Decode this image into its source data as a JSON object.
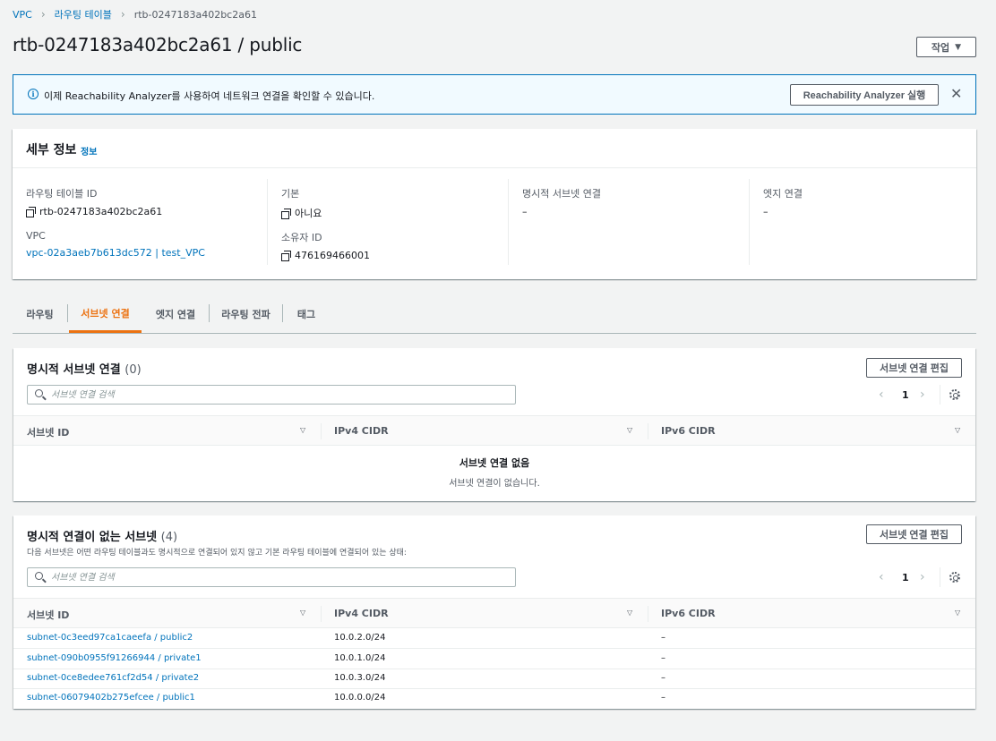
{
  "breadcrumb": {
    "items": [
      "VPC",
      "라우팅 테이블",
      "rtb-0247183a402bc2a61"
    ]
  },
  "header": {
    "title": "rtb-0247183a402bc2a61 / public",
    "actions_label": "작업"
  },
  "flash": {
    "message": "이제 Reachability Analyzer를 사용하여 네트워크 연결을 확인할 수 있습니다.",
    "button_label": "Reachability Analyzer 실행",
    "close_symbol": "✕"
  },
  "details": {
    "title": "세부 정보",
    "info_link": "정보",
    "route_table_id_label": "라우팅 테이블 ID",
    "route_table_id_value": "rtb-0247183a402bc2a61",
    "vpc_label": "VPC",
    "vpc_value": "vpc-02a3aeb7b613dc572 | test_VPC",
    "main_label": "기본",
    "main_value": "아니요",
    "owner_label": "소유자 ID",
    "owner_value": "476169466001",
    "explicit_subnet_label": "명시적 서브넷 연결",
    "explicit_subnet_value": "–",
    "edge_label": "엣지 연결",
    "edge_value": "–"
  },
  "tabs": [
    {
      "label": "라우팅"
    },
    {
      "label": "서브넷 연결"
    },
    {
      "label": "엣지 연결"
    },
    {
      "label": "라우팅 전파"
    },
    {
      "label": "태그"
    }
  ],
  "explicit": {
    "title": "명시적 서브넷 연결",
    "count": "(0)",
    "edit_label": "서브넷 연결 편집",
    "search_placeholder": "서브넷 연결 검색",
    "page": "1",
    "columns": [
      "서브넷 ID",
      "IPv4 CIDR",
      "IPv6 CIDR"
    ],
    "empty_title": "서브넷 연결 없음",
    "empty_sub": "서브넷 연결이 없습니다."
  },
  "implicit": {
    "title": "명시적 연결이 없는 서브넷",
    "count": "(4)",
    "description": "다음 서브넷은 어떤 라우팅 테이블과도 명시적으로 연결되어 있지 않고 기본 라우팅 테이블에 연결되어 있는 상태:",
    "edit_label": "서브넷 연결 편집",
    "search_placeholder": "서브넷 연결 검색",
    "page": "1",
    "columns": [
      "서브넷 ID",
      "IPv4 CIDR",
      "IPv6 CIDR"
    ],
    "rows": [
      {
        "subnet": "subnet-0c3eed97ca1caeefa / public2",
        "ipv4": "10.0.2.0/24",
        "ipv6": "–"
      },
      {
        "subnet": "subnet-090b0955f91266944 / private1",
        "ipv4": "10.0.1.0/24",
        "ipv6": "–"
      },
      {
        "subnet": "subnet-0ce8edee761cf2d54 / private2",
        "ipv4": "10.0.3.0/24",
        "ipv6": "–"
      },
      {
        "subnet": "subnet-06079402b275efcee / public1",
        "ipv4": "10.0.0.0/24",
        "ipv6": "–"
      }
    ]
  },
  "colors": {
    "link": "#0073bb",
    "active_tab": "#ec7211",
    "flash_bg": "#f1faff"
  }
}
